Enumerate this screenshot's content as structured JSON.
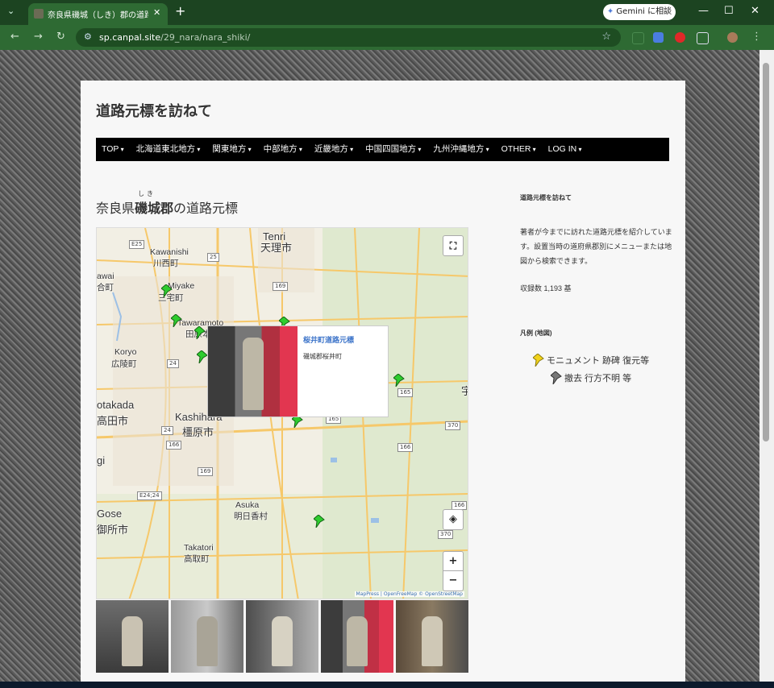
{
  "browser": {
    "tab_title": "奈良県磯城（しき）郡の道路元標",
    "new_tab": "+",
    "gemini_label": "Gemini に相談",
    "url_host": "sp.canpal.site",
    "url_path": "/29_nara/nara_shiki/"
  },
  "site": {
    "title": "道路元標を訪ねて",
    "menu": [
      "TOP",
      "北海道東北地方",
      "関東地方",
      "中部地方",
      "近畿地方",
      "中国四国地方",
      "九州沖縄地方",
      "OTHER",
      "LOG IN"
    ]
  },
  "post": {
    "title_prefix": "奈良県",
    "title_bold": "磯城郡",
    "title_suffix": "の道路元標",
    "ruby": "しき"
  },
  "map": {
    "labels": {
      "tenri_en": "Tenri",
      "tenri": "天理市",
      "kawanishi_en": "Kawanishi",
      "kawanishi": "川西町",
      "miyake_en": "Miyake",
      "miyake": "三宅町",
      "tawaramoto_en": "Tawaramoto",
      "tawaramoto": "田原本",
      "koryo_en": "Koryo",
      "koryo": "広陵町",
      "kawai_en": "awai",
      "kawai": "合町",
      "takada_en": "otakada",
      "takada": "高田市",
      "kashihara_en": "Kashihara",
      "kashihara": "橿原市",
      "gi": "gi",
      "gose_en": "Gose",
      "gose": "御所市",
      "asuka_en": "Asuka",
      "asuka": "明日香村",
      "takatori_en": "Takatori",
      "takatori": "高取町",
      "u": "宇"
    },
    "roads": [
      "E25",
      "25",
      "169",
      "24",
      "165",
      "370",
      "166",
      "24",
      "166",
      "169",
      "E24;24",
      "166",
      "370",
      "165"
    ],
    "popup": {
      "name": "桜井町道路元標",
      "address": "磯城郡桜井町"
    },
    "zoom_in": "+",
    "zoom_out": "−",
    "attribution": "MapPress | OpenFreeMap © OpenStreetMap",
    "fullscreen_icon": "fullscreen-icon",
    "locate_icon": "locate-icon"
  },
  "sidebar": {
    "heading": "道路元標を訪ねて",
    "description": "著者が今までに訪れた道路元標を紹介しています。設置当時の道府県郡別にメニューまたは地図から検索できます。",
    "count": "収録数 1,193 基",
    "legend_heading": "凡例 (地図)",
    "legend_existing": "モニュメント 跡碑 復元等",
    "legend_removed": "撤去 行方不明 等"
  },
  "colors": {
    "tab_bar": "#1c4421",
    "toolbar": "#2e6a33",
    "menu_bg": "#000000",
    "popup_link": "#3b73c9",
    "pin_green": "#2ecc2e",
    "pin_yellow": "#f1d21a",
    "pin_gray": "#777777"
  }
}
